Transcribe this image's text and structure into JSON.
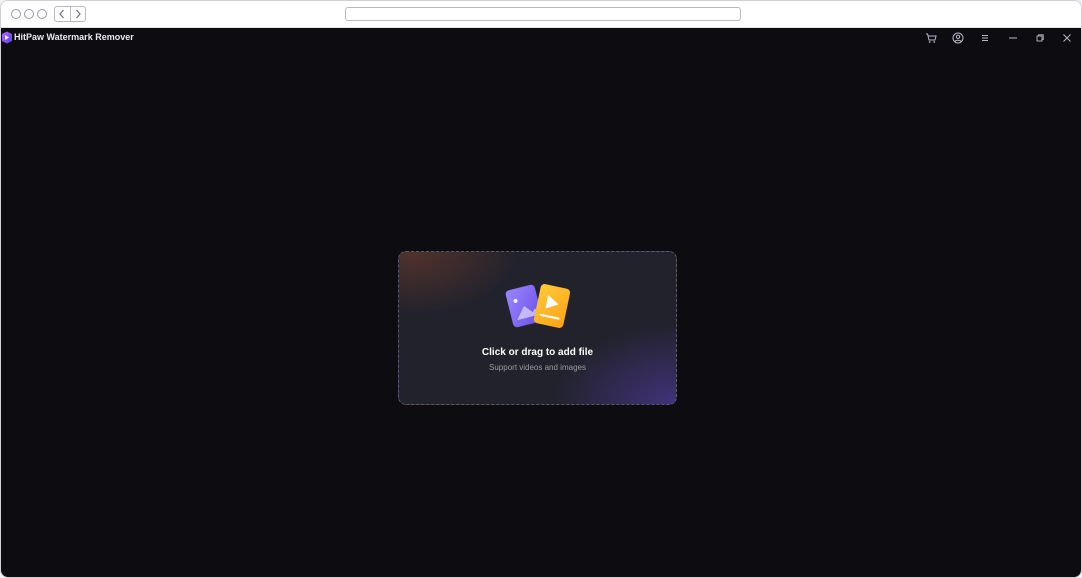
{
  "browser": {
    "url": "",
    "icons": {
      "back": "chevron-left-icon",
      "forward": "chevron-right-icon"
    }
  },
  "app": {
    "title": "HitPaw Watermark Remover",
    "toolbar_icons": [
      "cart-icon",
      "account-icon",
      "menu-icon",
      "minimize-icon",
      "restore-icon",
      "close-icon"
    ]
  },
  "dropzone": {
    "title": "Click or drag to add file",
    "subtitle": "Support videos and images",
    "colors": {
      "image_card": "#7b63f2",
      "video_card": "#ffb21a",
      "background": "#0d0d11"
    }
  }
}
